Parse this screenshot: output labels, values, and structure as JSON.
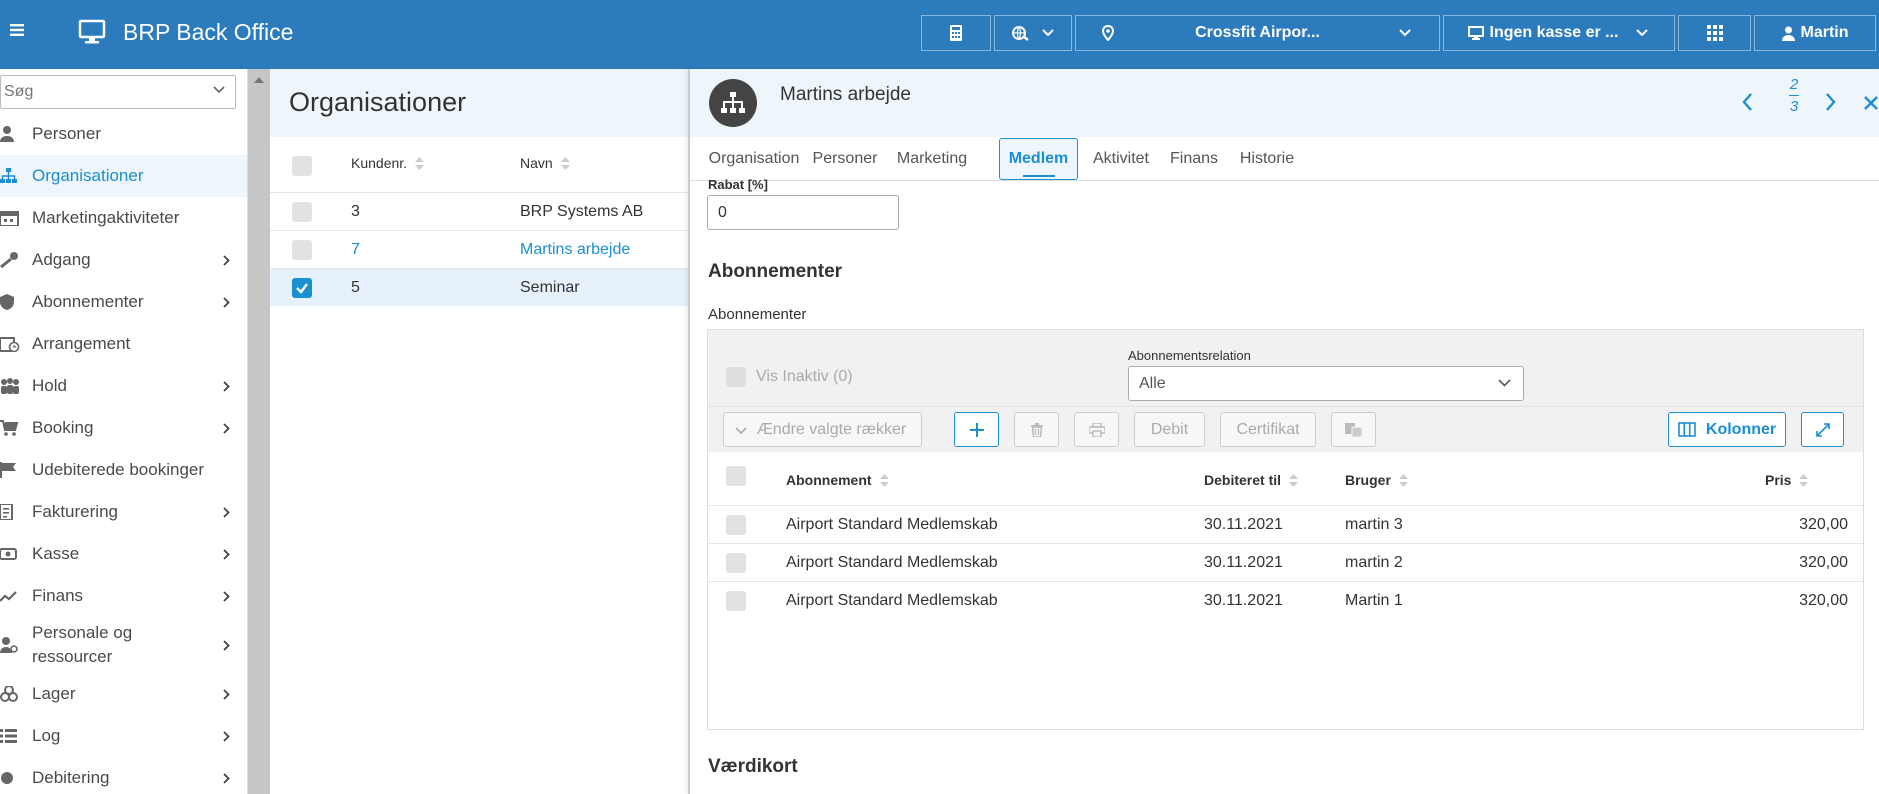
{
  "app": {
    "title": "BRP Back Office"
  },
  "topbar": {
    "location_label": "Crossfit Airpor...",
    "register_label": "Ingen kasse er ...",
    "user_label": "Martin"
  },
  "sidebar": {
    "search_placeholder": "Søg",
    "items": [
      {
        "label": "Personer",
        "icon": "person-icon",
        "has_arrow": false
      },
      {
        "label": "Organisationer",
        "icon": "org-chart-icon",
        "has_arrow": false,
        "active": true
      },
      {
        "label": "Marketingaktiviteter",
        "icon": "calendar-icon",
        "has_arrow": false
      },
      {
        "label": "Adgang",
        "icon": "key-icon",
        "has_arrow": true
      },
      {
        "label": "Abonnementer",
        "icon": "shield-icon",
        "has_arrow": true
      },
      {
        "label": "Arrangement",
        "icon": "calendar-clock-icon",
        "has_arrow": false
      },
      {
        "label": "Hold",
        "icon": "group-icon",
        "has_arrow": true
      },
      {
        "label": "Booking",
        "icon": "cart-icon",
        "has_arrow": true
      },
      {
        "label": "Udebiterede bookinger",
        "icon": "flag-icon",
        "has_arrow": false
      },
      {
        "label": "Fakturering",
        "icon": "invoice-icon",
        "has_arrow": true
      },
      {
        "label": "Kasse",
        "icon": "cash-icon",
        "has_arrow": true
      },
      {
        "label": "Finans",
        "icon": "trend-icon",
        "has_arrow": true
      },
      {
        "label": "Personale og ressourcer",
        "icon": "staff-icon",
        "has_arrow": true
      },
      {
        "label": "Lager",
        "icon": "boxes-icon",
        "has_arrow": true
      },
      {
        "label": "Log",
        "icon": "list-icon",
        "has_arrow": true
      },
      {
        "label": "Debitering",
        "icon": "debit-icon",
        "has_arrow": true
      }
    ]
  },
  "org_panel": {
    "title": "Organisationer",
    "columns": {
      "number": "Kundenr.",
      "name": "Navn"
    },
    "rows": [
      {
        "number": "3",
        "name": "BRP Systems AB"
      },
      {
        "number": "7",
        "name": "Martins arbejde"
      },
      {
        "number": "5",
        "name": "Seminar"
      }
    ]
  },
  "detail": {
    "title": "Martins arbejde",
    "pager_current": "2",
    "pager_total": "3",
    "tabs": [
      "Organisation",
      "Personer",
      "Marketing",
      "Medlem",
      "Aktivitet",
      "Finans",
      "Historie"
    ],
    "active_tab": "Medlem",
    "rabat_label": "Rabat [%]",
    "rabat_value": "0",
    "section_abonnementer": "Abonnementer",
    "sub_abonnementer": "Abonnementer",
    "vis_inaktiv": "Vis Inaktiv (0)",
    "relation_label": "Abonnementsrelation",
    "relation_value": "Alle",
    "toolbar": {
      "bulk_label": "Ændre valgte rækker",
      "debit_label": "Debit",
      "certificate_label": "Certifikat",
      "columns_label": "Kolonner"
    },
    "grid_columns": {
      "subscription": "Abonnement",
      "billed_until": "Debiteret til",
      "user": "Bruger",
      "price": "Pris"
    },
    "grid_rows": [
      {
        "subscription": "Airport Standard Medlemskab",
        "billed_until": "30.11.2021",
        "user": "martin 3",
        "price": "320,00"
      },
      {
        "subscription": "Airport Standard Medlemskab",
        "billed_until": "30.11.2021",
        "user": "martin 2",
        "price": "320,00"
      },
      {
        "subscription": "Airport Standard Medlemskab",
        "billed_until": "30.11.2021",
        "user": "Martin 1",
        "price": "320,00"
      }
    ],
    "section_vaerdikort": "Værdikort"
  },
  "colors": {
    "brand_blue": "#2b7bbd",
    "accent": "#1a8fd1"
  }
}
